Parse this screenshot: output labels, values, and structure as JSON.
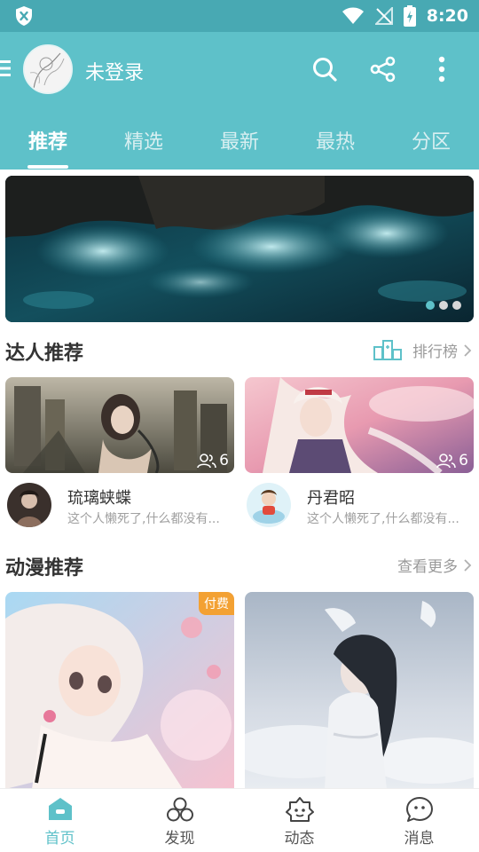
{
  "status_bar": {
    "time": "8:20"
  },
  "header": {
    "user_label": "未登录"
  },
  "tabs": [
    {
      "label": "推荐"
    },
    {
      "label": "精选"
    },
    {
      "label": "最新"
    },
    {
      "label": "最热"
    },
    {
      "label": "分区"
    }
  ],
  "banner": {
    "page_count": 3,
    "active_index": 0
  },
  "experts_section": {
    "title": "达人推荐",
    "more_label": "排行榜"
  },
  "experts": [
    {
      "name": "琉璃蛱蝶",
      "desc": "这个人懒死了,什么都没有...",
      "followers": "6"
    },
    {
      "name": "丹君昭",
      "desc": "这个人懒死了,什么都没有...",
      "followers": "6"
    }
  ],
  "anime_section": {
    "title": "动漫推荐",
    "more_label": "查看更多"
  },
  "anime_cards": [
    {
      "badge": "付费"
    }
  ],
  "bottom_nav": [
    {
      "label": "首页",
      "icon": "home-icon"
    },
    {
      "label": "发现",
      "icon": "discover-icon"
    },
    {
      "label": "动态",
      "icon": "activity-icon"
    },
    {
      "label": "消息",
      "icon": "message-icon"
    }
  ],
  "colors": {
    "accent": "#5ec1c9",
    "status_bar": "#48a9b3",
    "badge": "#f3a133"
  }
}
